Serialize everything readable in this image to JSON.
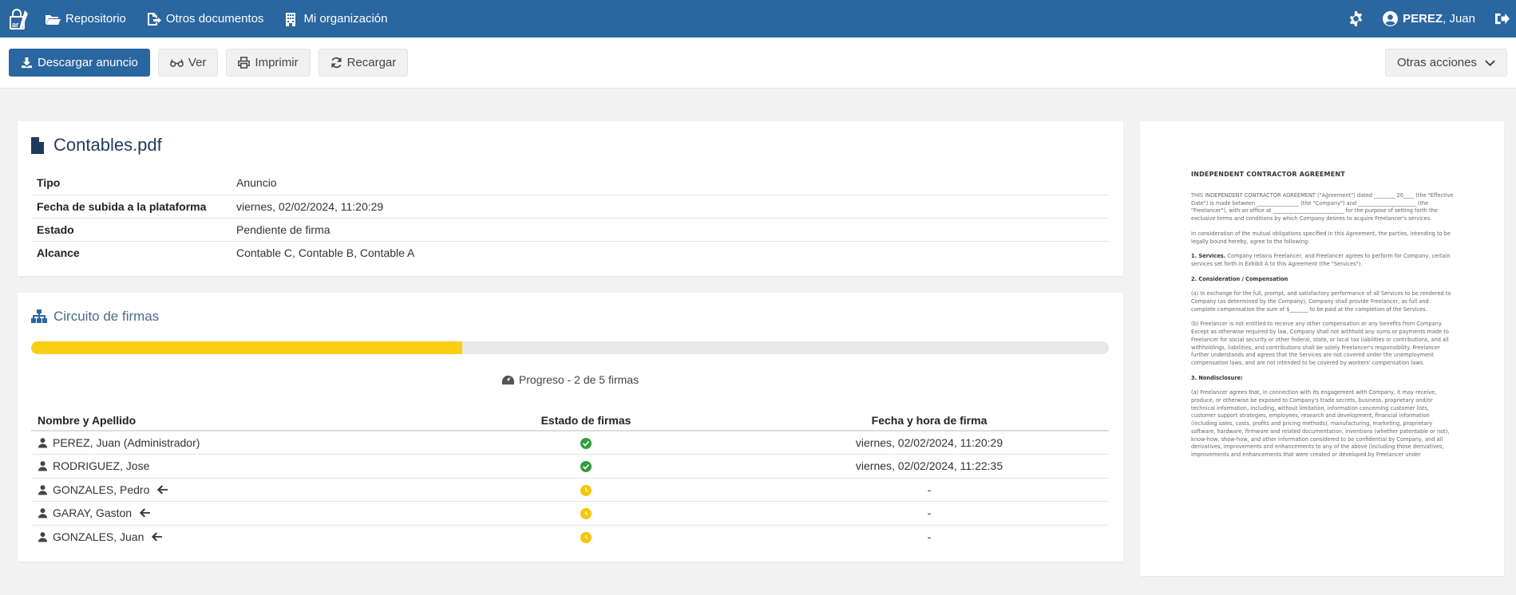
{
  "navbar": {
    "items": [
      {
        "label": "Repositorio"
      },
      {
        "label": "Otros documentos"
      },
      {
        "label": "Mi organización"
      }
    ],
    "user": {
      "last": "PEREZ",
      "first": ", Juan"
    }
  },
  "toolbar": {
    "download": "Descargar anuncio",
    "view": "Ver",
    "print": "Imprimir",
    "reload": "Recargar",
    "more": "Otras acciones"
  },
  "document": {
    "filename": "Contables.pdf",
    "rows": [
      {
        "key": "Tipo",
        "value": "Anuncio"
      },
      {
        "key": "Fecha de subida a la plataforma",
        "value": "viernes, 02/02/2024, 11:20:29"
      },
      {
        "key": "Estado",
        "value": "Pendiente de firma"
      },
      {
        "key": "Alcance",
        "value": "Contable C, Contable B, Contable A"
      }
    ]
  },
  "circuit": {
    "title": "Circuito de firmas",
    "progress_fraction": 0.4,
    "progress_label": "Progreso - 2 de 5 firmas",
    "progress_color": "#f9cf16",
    "columns": [
      "Nombre y Apellido",
      "Estado de firmas",
      "Fecha y hora de firma"
    ],
    "rows": [
      {
        "name": "PEREZ, Juan (Administrador)",
        "status": "signed",
        "date": "viernes, 02/02/2024, 11:20:29",
        "current": false
      },
      {
        "name": "RODRIGUEZ, Jose",
        "status": "signed",
        "date": "viernes, 02/02/2024, 11:22:35",
        "current": false
      },
      {
        "name": "GONZALES, Pedro",
        "status": "pending",
        "date": "-",
        "current": true
      },
      {
        "name": "GARAY, Gaston",
        "status": "pending",
        "date": "-",
        "current": true
      },
      {
        "name": "GONZALES, Juan",
        "status": "pending",
        "date": "-",
        "current": true
      }
    ]
  },
  "preview": {
    "title": "INDEPENDENT CONTRACTOR AGREEMENT",
    "p1": "THIS INDEPENDENT CONTRACTOR AGREEMENT (\"Agreement\") dated ________ 20____ (the \"Effective Date\") is made between ________________ (the \"Company\") and ______________________ (the \"Freelancer\"), with an office at ___________________________ for the purpose of setting forth the exclusive terms and conditions by which Company desires to acquire Freelancer's services.",
    "p2": "In consideration of the mutual obligations specified in this Agreement, the parties, intending to be legally bound hereby, agree to the following:",
    "s1_head": "1. Services.",
    "s1": "Company retains Freelancer, and Freelancer agrees to perform for Company, certain services set forth in Exhibit A to this Agreement (the \"Services\").",
    "s2_head": "2. Consideration / Compensation",
    "s2a": "(a) In exchange for the full, prompt, and satisfactory performance of all Services to be rendered to Company (as determined by the Company), Company shall provide Freelancer, as full and complete compensation the sum of $_______ to be paid at the completion of the Services.",
    "s2b": "(b) Freelancer is not entitled to receive any other compensation or any benefits from Company. Except as otherwise required by law, Company shall not withhold any sums or payments made to Freelancer for social security or other federal, state, or local tax liabilities or contributions, and all withholdings, liabilities, and contributions shall be solely Freelancer's responsibility. Freelancer further understands and agrees that the Services are not covered under the unemployment compensation laws, and are not intended to be covered by workers' compensation laws.",
    "s3_head": "3. Nondisclosure:",
    "s3a": "(a) Freelancer agrees that, in connection with its engagement with Company, it may receive, produce, or otherwise be exposed to Company's trade secrets, business, proprietary and/or technical information, including, without limitation, information concerning customer lists, customer support strategies, employees, research and development, financial information (including sales, costs, profits and pricing methods), manufacturing, marketing, proprietary software, hardware, firmware and related documentation, inventions (whether patentable or not), know-how, show-how, and other information considered to be confidential by Company, and all derivatives, improvements and enhancements to any of the above (including those derivatives, improvements and enhancements that were created or developed by Freelancer under"
  }
}
